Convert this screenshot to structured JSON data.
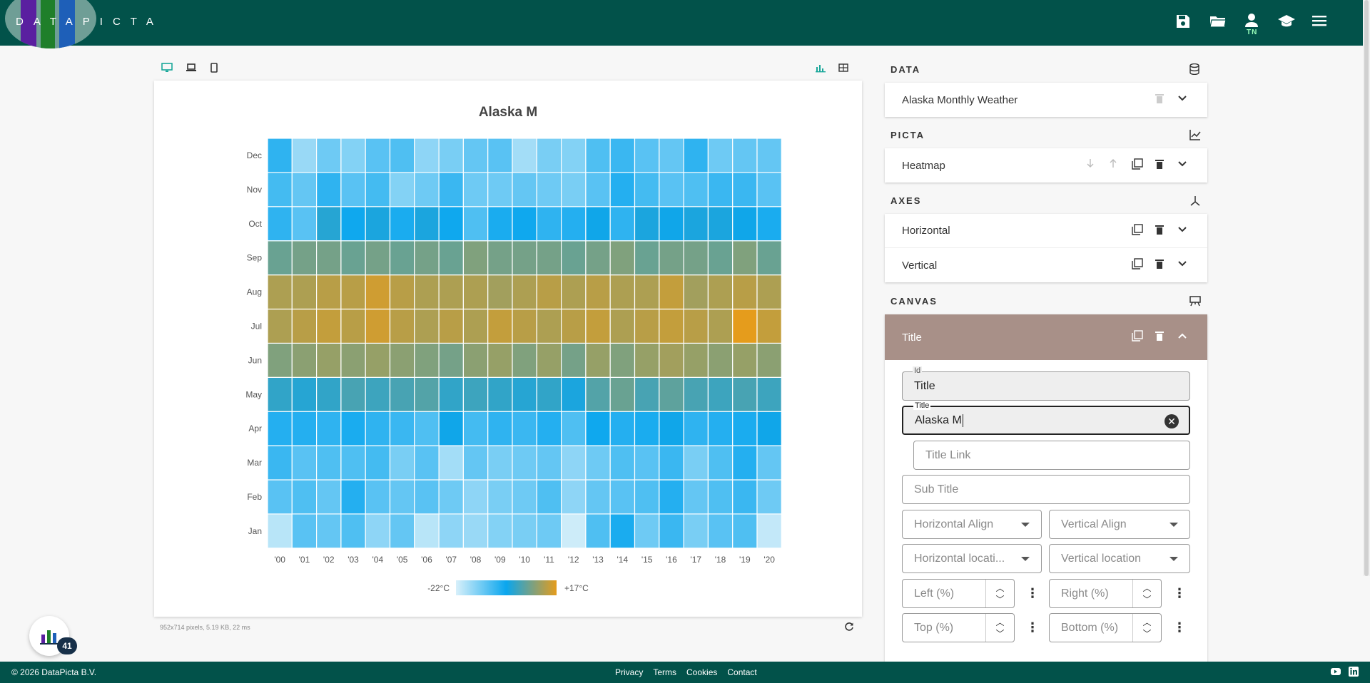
{
  "app": {
    "logo_text": "DATAPICTA",
    "user_initials": "TN"
  },
  "chart_data": {
    "type": "heatmap",
    "title": "Alaska M",
    "x": [
      "'00",
      "'01",
      "'02",
      "'03",
      "'04",
      "'05",
      "'06",
      "'07",
      "'08",
      "'09",
      "'10",
      "'11",
      "'12",
      "'13",
      "'14",
      "'15",
      "'16",
      "'17",
      "'18",
      "'19",
      "'20"
    ],
    "y": [
      "Jan",
      "Feb",
      "Mar",
      "Apr",
      "May",
      "Jun",
      "Jul",
      "Aug",
      "Sep",
      "Oct",
      "Nov",
      "Dec"
    ],
    "z": [
      [
        -19,
        -10,
        -11,
        -9,
        -15,
        -11,
        -19,
        -15,
        -16,
        -14,
        -13,
        -12,
        -21,
        -9,
        -4,
        -12,
        -7,
        -13,
        -10,
        -9,
        -20
      ],
      [
        -10,
        -9,
        -11,
        -5,
        -10,
        -11,
        -10,
        -12,
        -15,
        -13,
        -12,
        -9,
        -15,
        -11,
        -10,
        -9,
        -5,
        -11,
        -9,
        -7,
        -12
      ],
      [
        -7,
        -10,
        -9,
        -9,
        -8,
        -13,
        -10,
        -17,
        -11,
        -13,
        -12,
        -11,
        -15,
        -12,
        -9,
        -10,
        -7,
        -13,
        -9,
        -5,
        -11
      ],
      [
        -5,
        -5,
        -6,
        -4,
        -6,
        -7,
        -9,
        -2,
        -8,
        -6,
        -7,
        -5,
        -9,
        -3,
        -5,
        -4,
        -2,
        -6,
        -5,
        -4,
        -2
      ],
      [
        1,
        0,
        1,
        3,
        2,
        3,
        4,
        1,
        2,
        1,
        0,
        1,
        -1,
        4,
        6,
        3,
        5,
        3,
        2,
        3,
        2
      ],
      [
        8,
        9,
        10,
        9,
        10,
        9,
        8,
        7,
        9,
        10,
        8,
        10,
        7,
        10,
        8,
        10,
        11,
        10,
        9,
        10,
        9
      ],
      [
        12,
        13,
        14,
        13,
        15,
        13,
        12,
        13,
        12,
        14,
        13,
        12,
        13,
        14,
        12,
        13,
        14,
        13,
        12,
        17,
        14
      ],
      [
        12,
        12,
        13,
        13,
        15,
        13,
        12,
        12,
        12,
        11,
        12,
        13,
        12,
        13,
        12,
        12,
        14,
        11,
        12,
        13,
        12
      ],
      [
        6,
        7,
        7,
        6,
        7,
        6,
        7,
        6,
        8,
        7,
        7,
        7,
        6,
        7,
        8,
        6,
        7,
        7,
        6,
        8,
        6
      ],
      [
        -6,
        -10,
        0,
        -3,
        -1,
        -4,
        -1,
        -3,
        -9,
        -4,
        -3,
        -6,
        -5,
        -2,
        -6,
        -1,
        -2,
        -1,
        -1,
        -2,
        -4
      ],
      [
        -8,
        -11,
        -6,
        -10,
        -8,
        -14,
        -12,
        -7,
        -12,
        -12,
        -11,
        -12,
        -13,
        -10,
        -5,
        -8,
        -10,
        -9,
        -7,
        -7,
        -10
      ],
      [
        -6,
        -16,
        -12,
        -14,
        -10,
        -9,
        -15,
        -13,
        -11,
        -10,
        -17,
        -13,
        -14,
        -9,
        -7,
        -10,
        -11,
        -6,
        -12,
        -11,
        -11
      ]
    ],
    "colorbar": {
      "min_label": "-22°C",
      "max_label": "+17°C",
      "colors": [
        "#d8f0fa",
        "#0aa6ee",
        "#e59c1c"
      ]
    }
  },
  "canvas_status": "952x714 pixels, 5.19 KB, 22 ms",
  "panel": {
    "data": {
      "label": "DATA",
      "item": "Alaska Monthly Weather"
    },
    "picta": {
      "label": "PICTA",
      "item": "Heatmap"
    },
    "axes": {
      "label": "AXES",
      "items": [
        "Horizontal",
        "Vertical"
      ]
    },
    "canvas": {
      "label": "CANVAS",
      "item": "Title"
    },
    "form": {
      "id_label": "Id",
      "id_value": "Title",
      "title_label": "Title",
      "title_value": "Alaska M",
      "title_link_placeholder": "Title Link",
      "subtitle_placeholder": "Sub Title",
      "h_align": "Horizontal Align",
      "v_align": "Vertical Align",
      "h_location": "Horizontal locati...",
      "v_location": "Vertical location",
      "left": "Left (%)",
      "right": "Right (%)",
      "top": "Top (%)",
      "bottom": "Bottom (%)"
    }
  },
  "fab": {
    "badge": "41"
  },
  "footer": {
    "copyright": "© 2026 DataPicta B.V.",
    "links": [
      "Privacy",
      "Terms",
      "Cookies",
      "Contact"
    ]
  }
}
